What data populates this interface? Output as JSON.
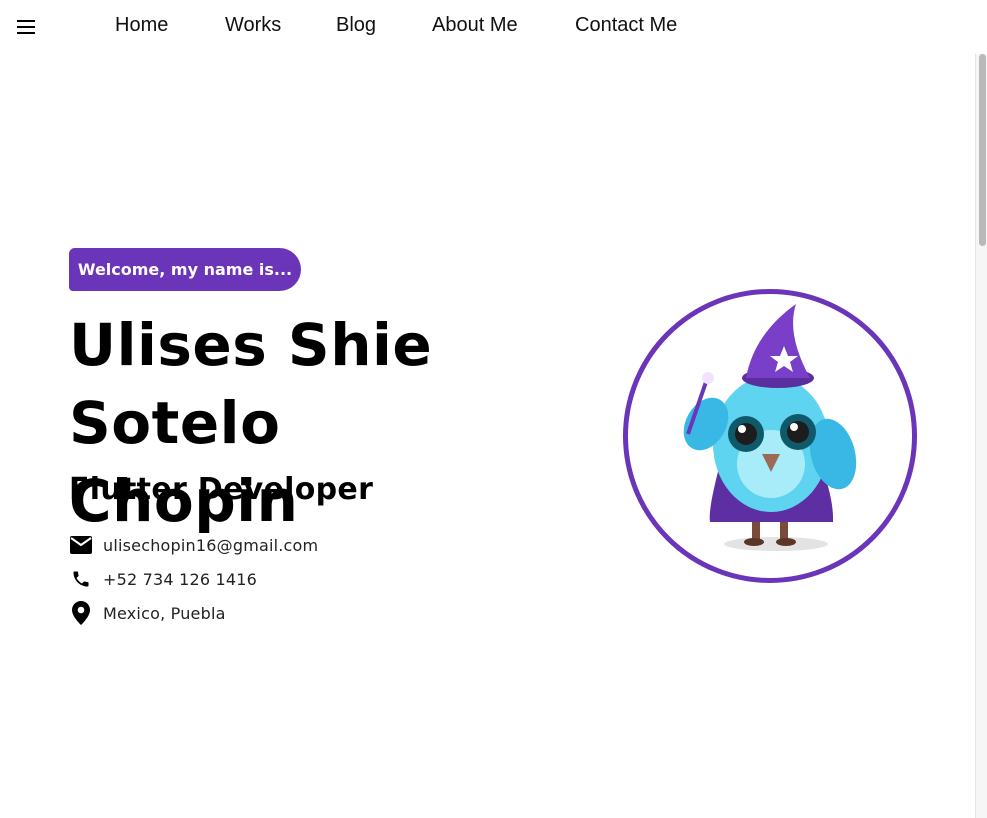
{
  "nav": {
    "items": [
      {
        "label": "Home"
      },
      {
        "label": "Works"
      },
      {
        "label": "Blog"
      },
      {
        "label": "About Me"
      },
      {
        "label": "Contact Me"
      }
    ]
  },
  "hero": {
    "welcome": "Welcome, my name is...",
    "name_line1": "Ulises Shie Sotelo",
    "name_line2": "Chopin",
    "role": "Flutter Developer",
    "contacts": {
      "email": "ulisechopin16@gmail.com",
      "phone": "+52 734 126 1416",
      "location": "Mexico, Puebla"
    }
  },
  "icons": {
    "menu": "menu-icon",
    "email": "email-icon",
    "phone": "phone-icon",
    "location": "location-pin-icon"
  },
  "colors": {
    "accent": "#6a35b8"
  }
}
